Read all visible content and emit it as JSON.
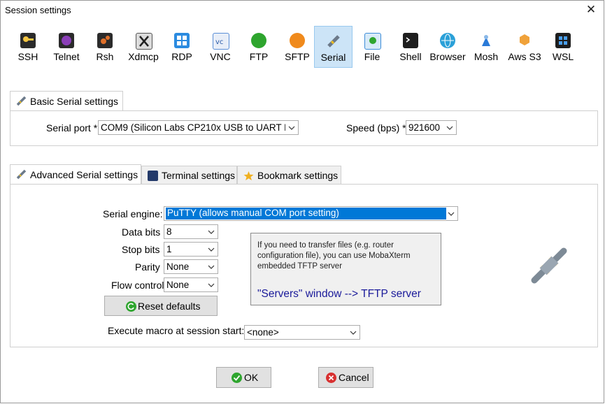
{
  "window": {
    "title": "Session settings",
    "close_glyph": "✕"
  },
  "toolbar": {
    "items": [
      {
        "label": "SSH",
        "icon": "key-icon",
        "color": "#f4c542",
        "selected": false
      },
      {
        "label": "Telnet",
        "icon": "telnet-icon",
        "color": "#8b3fb8",
        "selected": false
      },
      {
        "label": "Rsh",
        "icon": "rsh-icon",
        "color": "#e0702a",
        "selected": false
      },
      {
        "label": "Xdmcp",
        "icon": "xdmcp-icon",
        "color": "#3a3a3a",
        "selected": false
      },
      {
        "label": "RDP",
        "icon": "rdp-icon",
        "color": "#2b8be0",
        "selected": false
      },
      {
        "label": "VNC",
        "icon": "vnc-icon",
        "color": "#5a8ed6",
        "selected": false
      },
      {
        "label": "FTP",
        "icon": "ftp-icon",
        "color": "#2ea52e",
        "selected": false
      },
      {
        "label": "SFTP",
        "icon": "sftp-icon",
        "color": "#f08a1c",
        "selected": false
      },
      {
        "label": "Serial",
        "icon": "serial-plug-icon",
        "color": "#6c7a8a",
        "selected": true
      },
      {
        "label": "File",
        "icon": "file-icon",
        "color": "#3d8cd8",
        "selected": false
      },
      {
        "label": "Shell",
        "icon": "shell-icon",
        "color": "#1e1e1e",
        "selected": false
      },
      {
        "label": "Browser",
        "icon": "globe-icon",
        "color": "#2aa0d8",
        "selected": false
      },
      {
        "label": "Mosh",
        "icon": "mosh-icon",
        "color": "#2a7ad8",
        "selected": false
      },
      {
        "label": "Aws S3",
        "icon": "aws-s3-icon",
        "color": "#f0a23a",
        "selected": false
      },
      {
        "label": "WSL",
        "icon": "windows-icon",
        "color": "#2a6fd0",
        "selected": false
      }
    ]
  },
  "basic": {
    "tab_label": "Basic Serial settings",
    "serial_port_label": "Serial port *",
    "serial_port_value": "COM9  (Silicon Labs CP210x USB to UART B",
    "speed_label": "Speed (bps) *",
    "speed_value": "921600"
  },
  "advanced": {
    "tabs": [
      {
        "label": "Advanced Serial settings",
        "active": true
      },
      {
        "label": "Terminal settings",
        "active": false
      },
      {
        "label": "Bookmark settings",
        "active": false
      }
    ],
    "engine_label": "Serial engine:",
    "engine_value": "PuTTY    (allows manual COM port setting)",
    "data_bits_label": "Data bits",
    "data_bits_value": "8",
    "stop_bits_label": "Stop bits",
    "stop_bits_value": "1",
    "parity_label": "Parity",
    "parity_value": "None",
    "flow_label": "Flow control",
    "flow_value": "None",
    "reset_label": "Reset defaults",
    "info_text": "If you need to transfer files (e.g. router configuration file), you can use MobaXterm embedded TFTP server",
    "info_link": "\"Servers\" window  -->  TFTP server",
    "macro_label": "Execute macro at session start:",
    "macro_value": "<none>"
  },
  "buttons": {
    "ok": "OK",
    "cancel": "Cancel"
  },
  "colors": {
    "selected_bg": "#cce4f7",
    "highlight": "#0078d7",
    "link": "#1a1a9a"
  }
}
